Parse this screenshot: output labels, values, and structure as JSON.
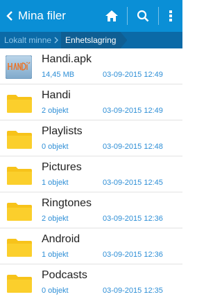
{
  "colors": {
    "action_bar": "#0a8fd6",
    "breadcrumb_bar": "#0b6aa7",
    "meta_text": "#2d8ed6",
    "folder": "#f7c31a"
  },
  "header": {
    "title": "Mina filer",
    "icons": [
      "back-arrow-icon",
      "home-icon",
      "search-icon",
      "overflow-menu-icon"
    ]
  },
  "breadcrumb": {
    "root": "Lokalt minne",
    "current": "Enhetslagring"
  },
  "items": [
    {
      "name": "Handi.apk",
      "meta": "14,45 MB",
      "date": "03-09-2015 12:49",
      "kind": "apk"
    },
    {
      "name": "Handi",
      "meta": "2 objekt",
      "date": "03-09-2015 12:49",
      "kind": "folder"
    },
    {
      "name": "Playlists",
      "meta": "0 objekt",
      "date": "03-09-2015 12:48",
      "kind": "folder"
    },
    {
      "name": "Pictures",
      "meta": "1 objekt",
      "date": "03-09-2015 12:45",
      "kind": "folder"
    },
    {
      "name": "Ringtones",
      "meta": "2 objekt",
      "date": "03-09-2015 12:36",
      "kind": "folder"
    },
    {
      "name": "Android",
      "meta": "1 objekt",
      "date": "03-09-2015 12:36",
      "kind": "folder"
    },
    {
      "name": "Podcasts",
      "meta": "0 objekt",
      "date": "03-09-2015 12:35",
      "kind": "folder"
    }
  ]
}
